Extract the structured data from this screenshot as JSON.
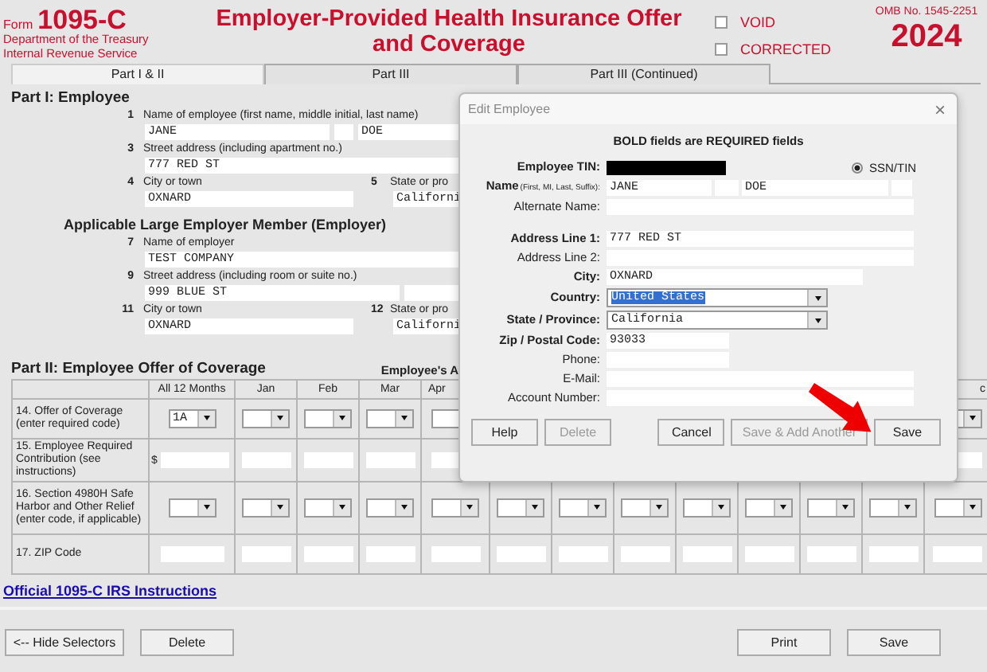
{
  "form_header": {
    "form_word": "Form",
    "form_number": "1095-C",
    "agency": [
      "Department of the Treasury",
      "Internal Revenue Service"
    ],
    "title": [
      "Employer-Provided Health Insurance Offer",
      "and Coverage"
    ],
    "checkboxes": [
      {
        "label": "VOID",
        "checked": false
      },
      {
        "label": "CORRECTED",
        "checked": false
      }
    ],
    "omb": "OMB No. 1545-2251",
    "year": "2024"
  },
  "tabs": [
    {
      "label": "Part I & II",
      "selected": true
    },
    {
      "label": "Part III",
      "selected": false
    },
    {
      "label": "Part III (Continued)",
      "selected": false
    }
  ],
  "part1": {
    "heading": "Part I:  Employee",
    "employee_fields": [
      {
        "kind": "name",
        "number": "1",
        "label": "Name of employee (first name, middle initial, last name)",
        "first": "JANE",
        "last": "DOE"
      },
      {
        "kind": "street",
        "number": "3",
        "label": "Street address (including apartment no.)",
        "value": "777 RED ST"
      },
      {
        "kind": "city_state",
        "number": "4",
        "label": "City or town",
        "value": "OXNARD",
        "state_number": "5",
        "state_label": "State or pro",
        "state_value": "Californi"
      }
    ],
    "employer_heading": "Applicable Large Employer Member (Employer)",
    "employer_fields": [
      {
        "kind": "street",
        "number": "7",
        "label": "Name of employer",
        "value": "TEST COMPANY"
      },
      {
        "kind": "street_room",
        "number": "9",
        "label": "Street address (including room or suite no.)",
        "value": "999 BLUE ST"
      },
      {
        "kind": "city_state",
        "number": "11",
        "label": "City or town",
        "value": "OXNARD",
        "state_number": "12",
        "state_label": "State or pro",
        "state_value": "Californi"
      }
    ]
  },
  "part2": {
    "heading": "Part II:  Employee Offer of Coverage",
    "side_heading": "Employee's A",
    "columns": [
      {
        "header": "All 12 Months"
      },
      {
        "header": "Jan"
      },
      {
        "header": "Feb"
      },
      {
        "header": "Mar"
      },
      {
        "header": "Apr"
      },
      {},
      {},
      {},
      {},
      {},
      {},
      {},
      {
        "header": "c"
      }
    ],
    "rows": [
      {
        "kind": "select",
        "label": "14.  Offer of Coverage (enter required code)",
        "all_value": "1A"
      },
      {
        "kind": "money",
        "label": "15.  Employee Required Contribution (see instructions)",
        "currency": "$"
      },
      {
        "kind": "select",
        "label": "16.  Section 4980H Safe Harbor and Other Relief (enter code, if applicable)"
      },
      {
        "kind": "text",
        "label": "17.  ZIP Code"
      }
    ]
  },
  "link": "Official 1095-C IRS Instructions",
  "bottom_buttons": {
    "left": [
      "<-- Hide Selectors",
      "Delete"
    ],
    "right": [
      "Print",
      "Save"
    ]
  },
  "dialog": {
    "title": "Edit Employee",
    "close": "×",
    "note": "BOLD fields are REQUIRED fields",
    "sections": [
      [
        {
          "kind": "tin",
          "label": "Employee TIN:",
          "required": true,
          "radio": {
            "label": "SSN/TIN",
            "selected": true
          }
        },
        {
          "kind": "name",
          "label": "Name",
          "hint": "(First, MI, Last, Suffix):",
          "required": true,
          "first": "JANE",
          "last": "DOE"
        },
        {
          "kind": "text",
          "label": "Alternate Name:",
          "required": false
        }
      ],
      [
        {
          "kind": "text",
          "label": "Address Line 1:",
          "required": true,
          "value": "777 RED ST"
        },
        {
          "kind": "text",
          "label": "Address Line 2:",
          "required": false
        },
        {
          "kind": "medium_text",
          "label": "City:",
          "required": true,
          "value": "OXNARD"
        },
        {
          "kind": "select",
          "label": "Country:",
          "required": true,
          "value": "United States",
          "highlighted": true
        },
        {
          "kind": "select",
          "label": "State / Province:",
          "required": true,
          "value": "California",
          "highlighted": false
        },
        {
          "kind": "short_text",
          "label": "Zip / Postal Code:",
          "required": true,
          "value": "93033"
        },
        {
          "kind": "short_text",
          "label": "Phone:",
          "required": false
        },
        {
          "kind": "text",
          "label": "E-Mail:",
          "required": false
        },
        {
          "kind": "text",
          "label": "Account Number:",
          "required": false
        }
      ]
    ],
    "buttons_left": [
      {
        "label": "Help",
        "disabled": false
      },
      {
        "label": "Delete",
        "disabled": true
      }
    ],
    "buttons_right": [
      {
        "label": "Cancel",
        "disabled": false
      },
      {
        "label": "Save & Add Another",
        "disabled": true
      },
      {
        "label": "Save",
        "disabled": false
      }
    ]
  }
}
